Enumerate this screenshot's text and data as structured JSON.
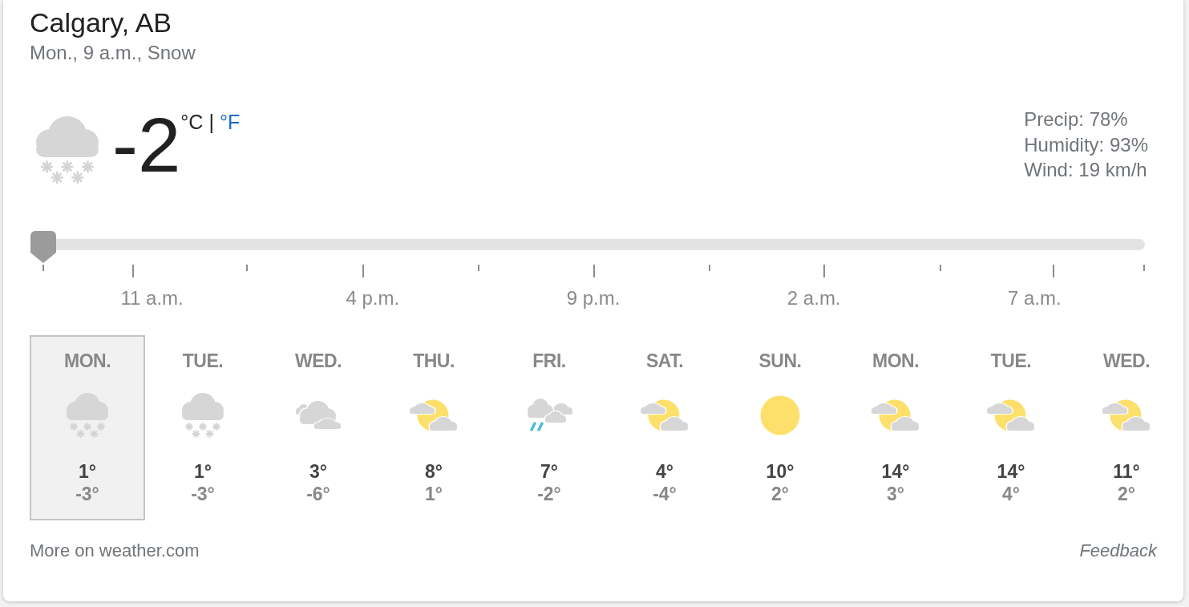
{
  "location": {
    "title": "Calgary, AB",
    "subtitle": "Mon., 9 a.m., Snow"
  },
  "current": {
    "kind": "snow",
    "temperature": "-2",
    "units": [
      {
        "label": "°C",
        "selected": true
      },
      {
        "label": "°F",
        "selected": false
      }
    ],
    "unit_separator": "|",
    "details": [
      "Precip: 78%",
      "Humidity: 93%",
      "Wind: 19 km/h"
    ]
  },
  "timeline": {
    "level": 0,
    "labels": [
      "11 a.m.",
      "4 p.m.",
      "9 p.m.",
      "2 a.m.",
      "7 a.m."
    ]
  },
  "days": [
    {
      "day": "MON.",
      "kind": "snow",
      "high": "1°",
      "low": "-3°",
      "selected": true
    },
    {
      "day": "TUE.",
      "kind": "snow",
      "high": "1°",
      "low": "-3°",
      "selected": false
    },
    {
      "day": "WED.",
      "kind": "cloudy",
      "high": "3°",
      "low": "-6°",
      "selected": false
    },
    {
      "day": "THU.",
      "kind": "partly_cloudy",
      "high": "8°",
      "low": "1°",
      "selected": false
    },
    {
      "day": "FRI.",
      "kind": "rain",
      "high": "7°",
      "low": "-2°",
      "selected": false
    },
    {
      "day": "SAT.",
      "kind": "partly_cloudy",
      "high": "4°",
      "low": "-4°",
      "selected": false
    },
    {
      "day": "SUN.",
      "kind": "sunny",
      "high": "10°",
      "low": "2°",
      "selected": false
    },
    {
      "day": "MON.",
      "kind": "partly_cloudy",
      "high": "14°",
      "low": "3°",
      "selected": false
    },
    {
      "day": "TUE.",
      "kind": "partly_cloudy",
      "high": "14°",
      "low": "4°",
      "selected": false
    },
    {
      "day": "WED.",
      "kind": "partly_cloudy",
      "high": "11°",
      "low": "2°",
      "selected": false
    }
  ],
  "footer": {
    "more_link": "More on weather.com",
    "feedback": "Feedback"
  }
}
